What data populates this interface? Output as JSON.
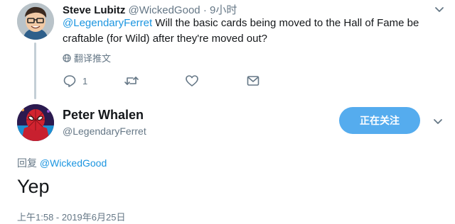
{
  "parent_tweet": {
    "name": "Steve Lubitz",
    "handle": "@WickedGood",
    "separator": "·",
    "time": "9小时",
    "mention": "@LegendaryFerret",
    "text": " Will the basic cards being moved to the Hall of Fame be craftable (for Wild) after they're moved out?",
    "translate_label": "翻译推文",
    "reply_count": "1",
    "avatar_icon": "cartoon-avatar-icon"
  },
  "main_tweet": {
    "name": "Peter Whalen",
    "handle": "@LegendaryFerret",
    "follow_label": "正在关注",
    "reply_prefix": "回复",
    "reply_mention": "@WickedGood",
    "text": "Yep",
    "timestamp": "上午1:58 - 2019年6月25日",
    "avatar_icon": "spiderman-avatar-icon"
  },
  "colors": {
    "accent": "#1b95e0",
    "follow_bg": "#55acee",
    "muted": "#657786",
    "text": "#14171a"
  }
}
